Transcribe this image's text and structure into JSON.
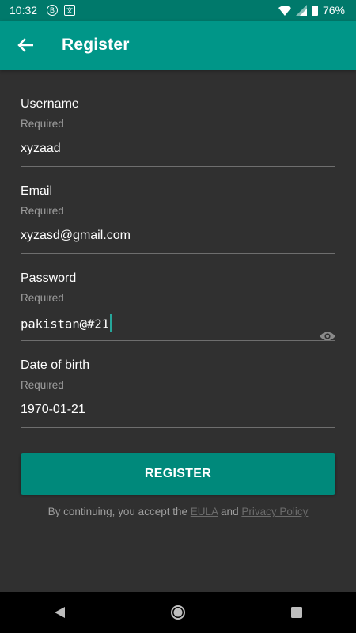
{
  "status_bar": {
    "time": "10:32",
    "left_icons": [
      "b-icon",
      "translate-icon"
    ],
    "battery": "76%"
  },
  "app_bar": {
    "title": "Register",
    "back_icon": "arrow-back-icon"
  },
  "form": {
    "username": {
      "label": "Username",
      "helper": "Required",
      "value": "xyzaad"
    },
    "email": {
      "label": "Email",
      "helper": "Required",
      "value": "xyzasd@gmail.com"
    },
    "password": {
      "label": "Password",
      "helper": "Required",
      "value": "pakistan@#21",
      "toggle_icon": "eye-icon"
    },
    "dob": {
      "label": "Date of birth",
      "helper": "Required",
      "value": "1970-01-21"
    }
  },
  "register_button": "REGISTER",
  "terms": {
    "prefix": "By continuing, you accept the",
    "eula": "EULA",
    "conj": "and",
    "privacy": "Privacy Policy"
  },
  "colors": {
    "status_bar": "#00796B",
    "app_bar": "#009688",
    "button": "#00897B",
    "background": "#303030"
  }
}
